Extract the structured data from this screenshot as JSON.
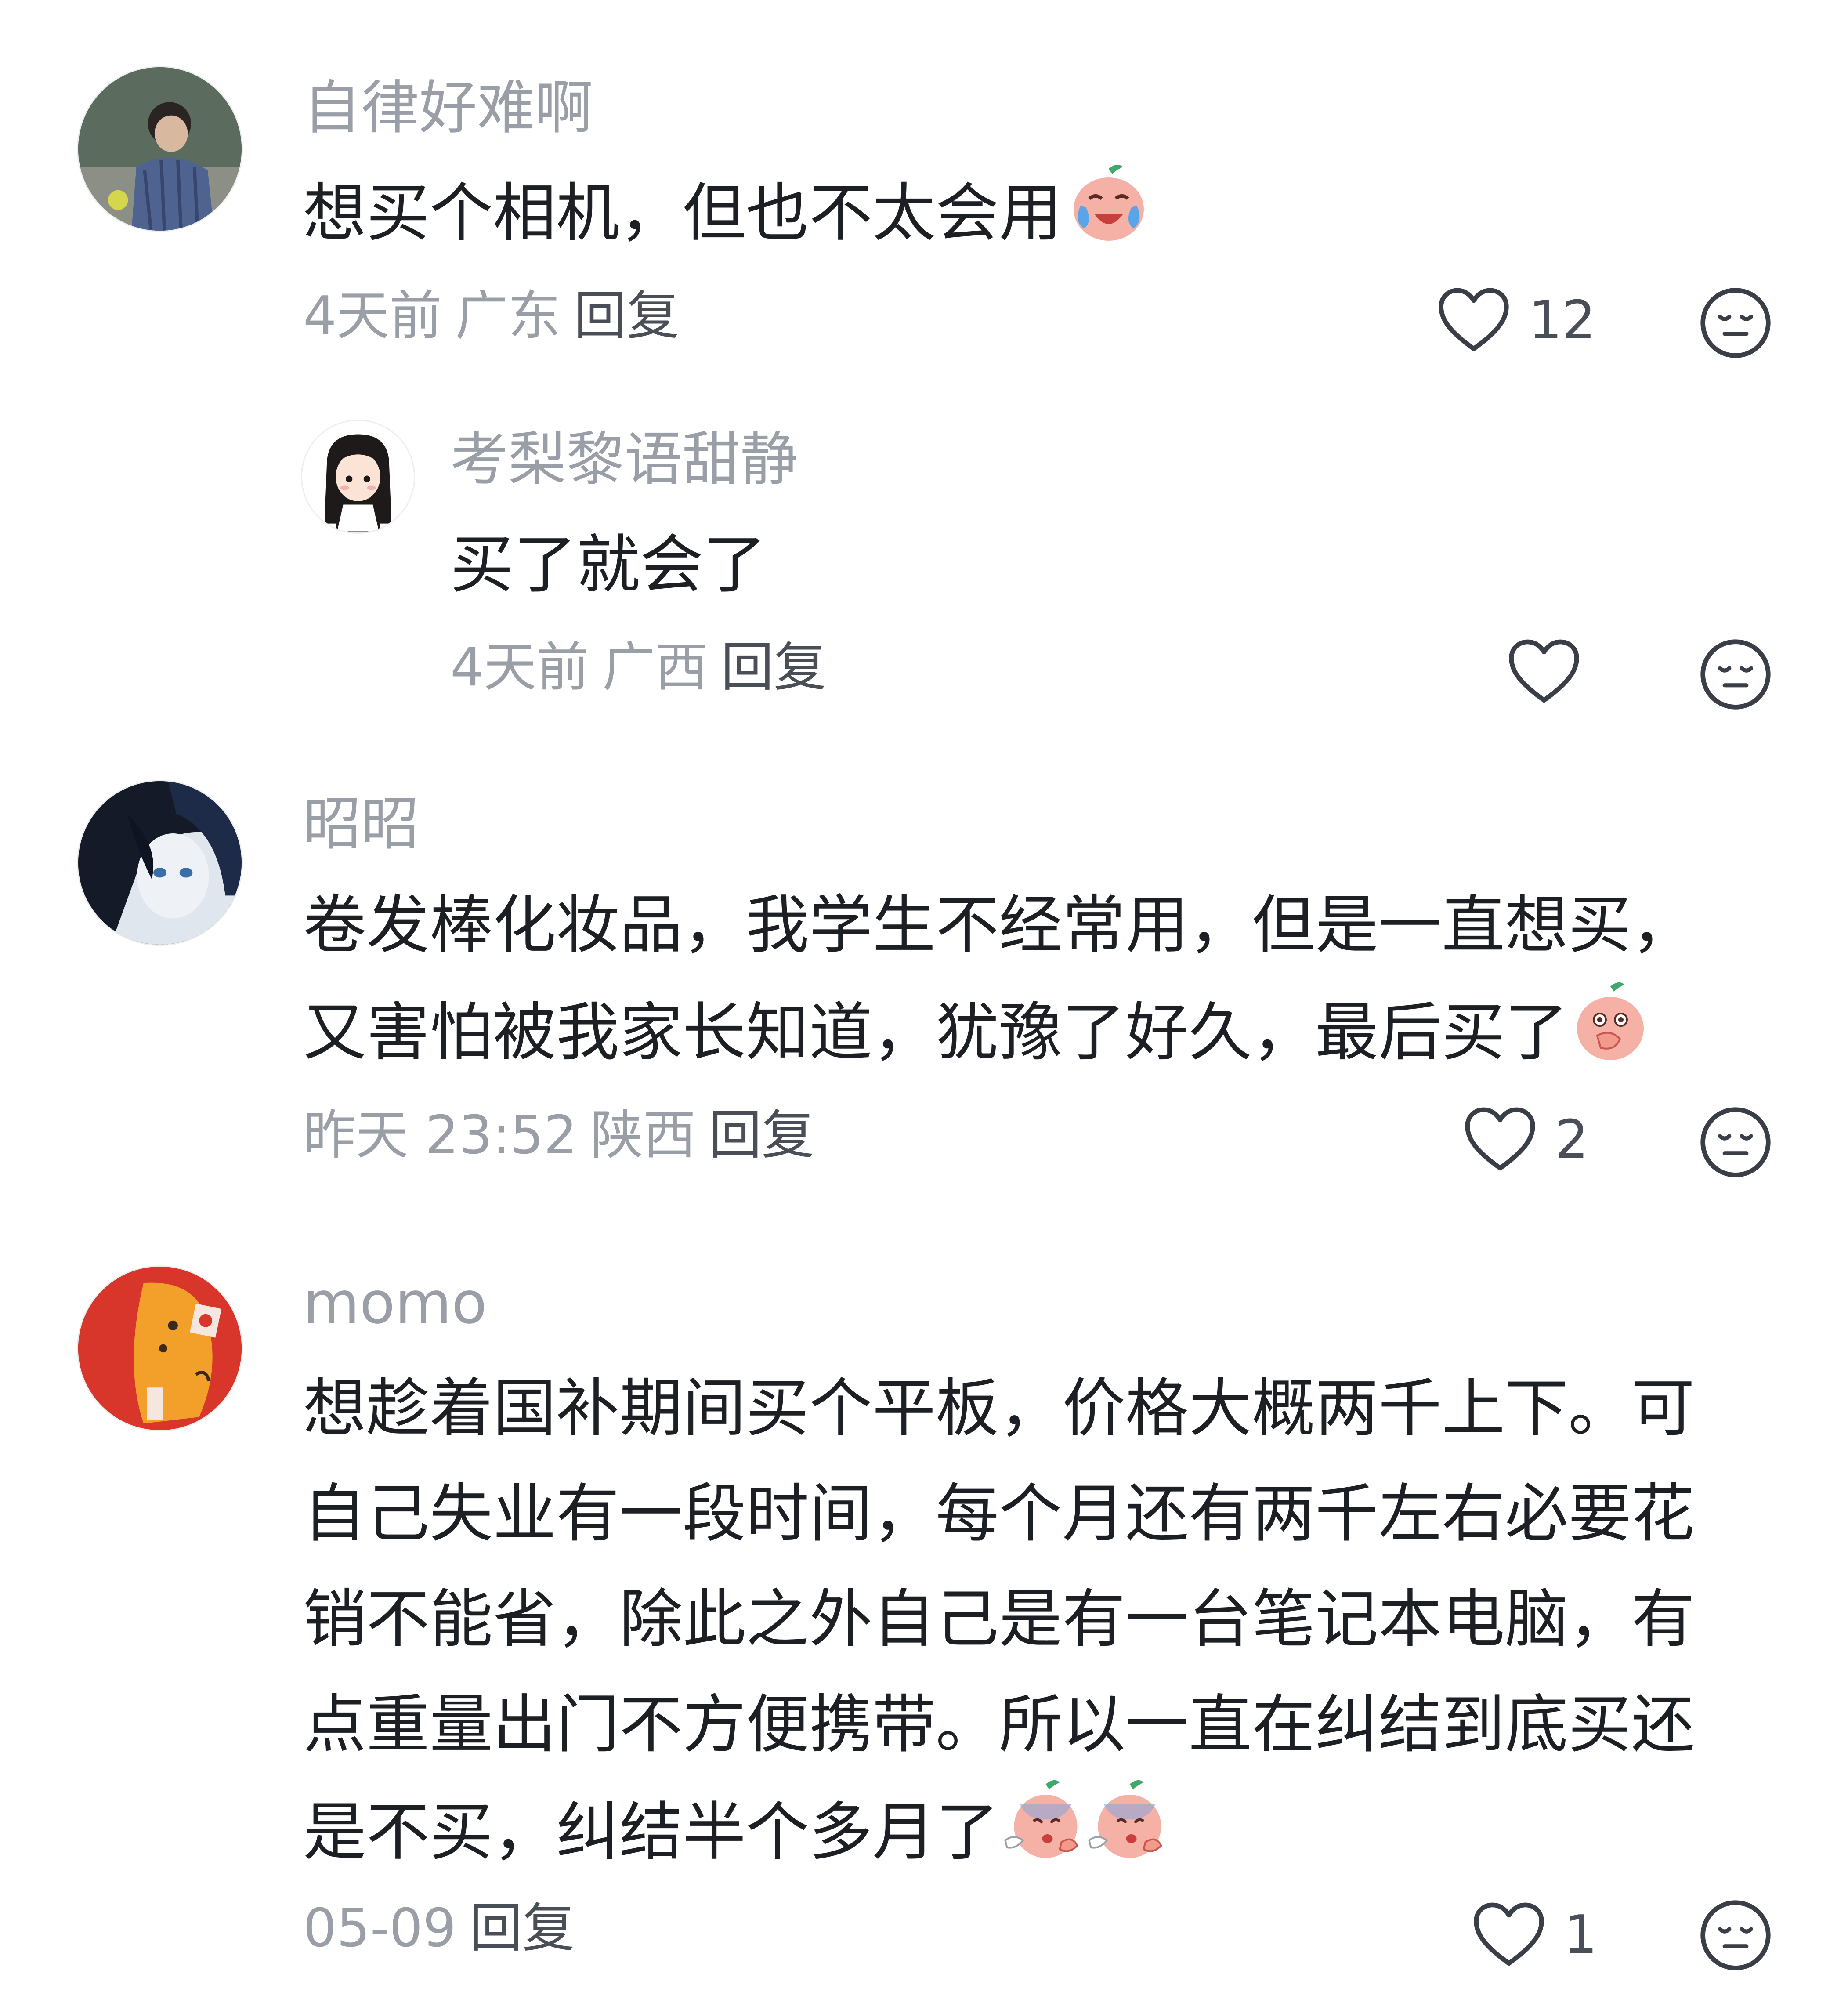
{
  "comments": [
    {
      "username": "自律好难啊",
      "text": "想买个相机，但也不太会用",
      "emoji": [
        "crying-laughing-peach-emoji"
      ],
      "time": "4天前",
      "location": "广东",
      "reply_label": "回复",
      "likes": "12",
      "avatar": "photo-young-man-plaid-shirt"
    },
    {
      "username": "考梨黎语甜静",
      "text": "买了就会了",
      "emoji": [],
      "time": "4天前",
      "location": "广西",
      "reply_label": "回复",
      "likes": "",
      "avatar": "cartoon-girl-long-black-hair"
    },
    {
      "username": "昭昭",
      "text": "卷发棒化妆品，我学生不经常用，但是一直想买，又害怕被我家长知道，犹豫了好久，最后买了",
      "emoji": [
        "peach-covering-mouth-emoji"
      ],
      "time": "昨天 23:52",
      "location": "陕西",
      "reply_label": "回复",
      "likes": "2",
      "avatar": "anime-girl-dark-hair"
    },
    {
      "username": "momo",
      "text": "想趁着国补期间买个平板，价格大概两千上下。可自己失业有一段时间，每个月还有两千左右必要花销不能省，除此之外自己是有一台笔记本电脑，有点重量出门不方便携带。所以一直在纠结到底买还是不买，纠结半个多月了",
      "emoji": [
        "peach-sighing-emoji",
        "peach-sighing-emoji"
      ],
      "time": "05-09",
      "location": "",
      "reply_label": "回复",
      "likes": "1",
      "avatar": "orange-cartoon-bag-illustration"
    }
  ],
  "colors": {
    "username": "#9a9ea6",
    "text": "#1c1f23",
    "meta": "#9a9ea6",
    "icon": "#3a3f47"
  },
  "icons": {
    "like": "heart-outline-icon",
    "dislike": "neutral-face-icon"
  }
}
